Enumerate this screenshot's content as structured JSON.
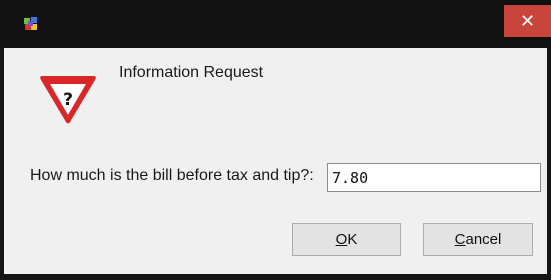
{
  "dialog": {
    "close_symbol": "✕",
    "heading": "Information Request",
    "icon": "question-warning-icon",
    "prompt": "How much is the bill before tax and tip?:",
    "input_value": "7.80",
    "ok": {
      "mnemonic": "O",
      "rest": "K"
    },
    "cancel": {
      "mnemonic": "C",
      "rest": "ancel"
    }
  },
  "colors": {
    "titlebar": "#111111",
    "close_button": "#c7453b",
    "dialog_background": "#f0f0f0",
    "warning_red": "#d92727"
  }
}
